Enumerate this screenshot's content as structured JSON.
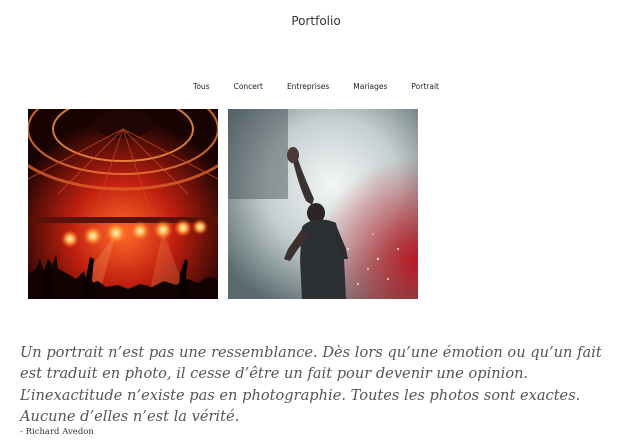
{
  "header": {
    "title": "Portfolio"
  },
  "filters": {
    "items": [
      "Tous",
      "Concert",
      "Entreprises",
      "Mariages",
      "Portrait"
    ]
  },
  "gallery": {
    "photos": [
      {
        "subject": "concert-stage-lights"
      },
      {
        "subject": "performer-raised-arm-smoke"
      }
    ]
  },
  "quote": {
    "text": "Un portrait n’est pas une ressemblance. Dès lors qu’une émotion ou qu’un fait est traduit en photo, il cesse d’être un fait pour devenir une opinion. L’inexactitude n’existe pas en photographie. Toutes les photos sont exactes. Aucune d’elles n’est la vérité.",
    "author": "- Richard Avedon"
  },
  "colors": {
    "background": "#ffffff",
    "text": "#333333",
    "quote_text": "#555555",
    "stage_red": "#e63a1e"
  }
}
